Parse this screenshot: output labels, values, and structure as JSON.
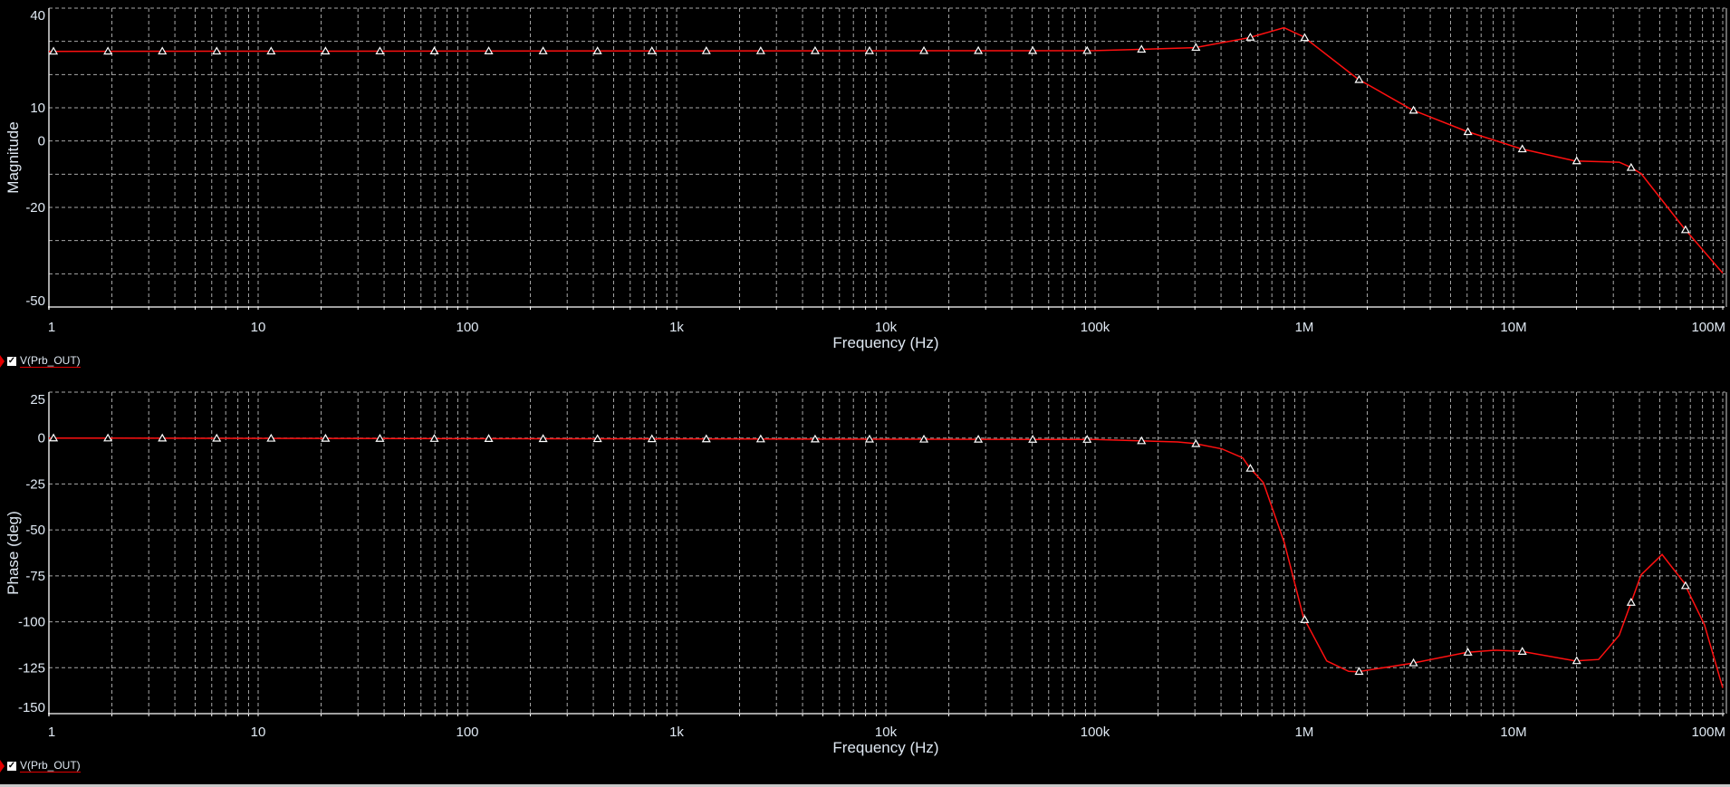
{
  "legend_label": "V(Prb_OUT)",
  "colors": {
    "trace": "#ff1010",
    "grid": "#a8a8a8",
    "axis": "#ffffff",
    "text": "#dfe8f2",
    "background": "#000000"
  },
  "chart_data": [
    {
      "type": "line",
      "title": "",
      "xlabel": "Frequency (Hz)",
      "ylabel": "Magnitude",
      "xscale": "log",
      "xlim": [
        1,
        100000000
      ],
      "ylim": [
        -50,
        40
      ],
      "grid": true,
      "x_tick_labels": [
        "1",
        "10",
        "100",
        "1k",
        "10k",
        "100k",
        "1M",
        "10M",
        "100M"
      ],
      "y_ticks": [
        {
          "v": 40,
          "label": "40"
        },
        {
          "v": 10,
          "label": "10"
        },
        {
          "v": 0,
          "label": "0"
        },
        {
          "v": -20,
          "label": "-20"
        },
        {
          "v": -50,
          "label": "-50"
        }
      ],
      "y_grid_step": 10,
      "legend": "bottom-left",
      "series": [
        {
          "name": "V(Prb_OUT)",
          "x": [
            1,
            100000,
            150000,
            300000,
            545000,
            800000,
            990000,
            1800000,
            3270000,
            5960000,
            10800000,
            19700000,
            32000000,
            36000000,
            40700000,
            65000000,
            100000000
          ],
          "y": [
            27,
            27.2,
            27.5,
            28.1,
            31.1,
            34.1,
            31.4,
            18.7,
            9.4,
            2.9,
            -2.3,
            -6.0,
            -6.4,
            -7.8,
            -9.8,
            -26.1,
            -39.8
          ]
        }
      ]
    },
    {
      "type": "line",
      "title": "",
      "xlabel": "Frequency (Hz)",
      "ylabel": "Phase (deg)",
      "xscale": "log",
      "xlim": [
        1,
        100000000
      ],
      "ylim": [
        -150,
        25
      ],
      "grid": true,
      "x_tick_labels": [
        "1",
        "10",
        "100",
        "1k",
        "10k",
        "100k",
        "1M",
        "10M",
        "100M"
      ],
      "y_ticks": [
        {
          "v": 25,
          "label": "25"
        },
        {
          "v": 0,
          "label": "0"
        },
        {
          "v": -25,
          "label": "-25"
        },
        {
          "v": -50,
          "label": "-50"
        },
        {
          "v": -75,
          "label": "-75"
        },
        {
          "v": -100,
          "label": "-100"
        },
        {
          "v": -125,
          "label": "-125"
        },
        {
          "v": -150,
          "label": "-150"
        }
      ],
      "y_grid_step": 25,
      "legend": "bottom-left",
      "series": [
        {
          "name": "V(Prb_OUT)",
          "x": [
            1,
            100000,
            248000,
            300000,
            404000,
            508000,
            545000,
            638000,
            804000,
            990000,
            1280000,
            1630000,
            1800000,
            3270000,
            5960000,
            8100000,
            10800000,
            19700000,
            25500000,
            32000000,
            36100000,
            40700000,
            51300000,
            65200000,
            81800000,
            100000000
          ],
          "y": [
            0,
            -0.8,
            -2.1,
            -3.0,
            -5.9,
            -10.8,
            -15.8,
            -24.3,
            -57.2,
            -97.5,
            -121.3,
            -127,
            -127.2,
            -122.6,
            -116.7,
            -115.5,
            -116,
            -121.3,
            -120.5,
            -107.3,
            -90.9,
            -74.5,
            -63.4,
            -78.6,
            -101.6,
            -136
          ]
        }
      ]
    }
  ]
}
